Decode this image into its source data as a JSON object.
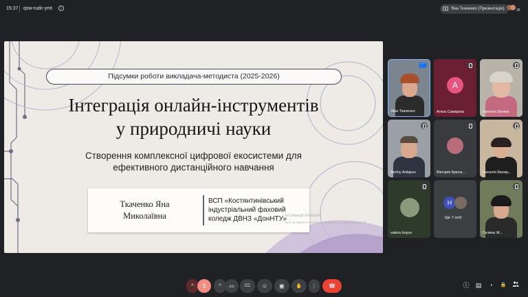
{
  "topbar": {
    "time": "15:37",
    "meeting_code": "qsw-rudc-ymt",
    "presenting_label": "Яна Ткаченко (Презентація)",
    "participants_count": "16"
  },
  "slide": {
    "banner": "Підсумки роботи викладача-методиста (2025-2026)",
    "title_line1": "Інтеграція онлайн-інструментів",
    "title_line2": "у природничі науки",
    "subtitle_line1": "Створення комплексної цифрової екосистеми для",
    "subtitle_line2": "ефективного дистанційного навчання",
    "author_line1": "Ткаченко Яна",
    "author_line2": "Миколаївна",
    "org_line1": "ВСП «Костянтинівський",
    "org_line2": "індустріальний фаховий",
    "org_line3": "коледж ДВНЗ «ДонНТУ»",
    "watermark_line1": "Активація Windows",
    "watermark_line2": "Щоб активувати Windows, перейдіть у розділ Параметри."
  },
  "participants": [
    {
      "name": "Яна Ткаченко",
      "state": "more"
    },
    {
      "name": "Аліна Самаріна",
      "avatar_letter": "A",
      "state": "muted"
    },
    {
      "name": "Наталія Зеніна",
      "state": "muted"
    },
    {
      "name": "Serhiy Artiapov",
      "state": "muted"
    },
    {
      "name": "Вікторія Крючк...",
      "state": "muted"
    },
    {
      "name": "Наталія Бікову...",
      "state": "muted"
    },
    {
      "name": "valera boyus",
      "state": "muted"
    },
    {
      "name": "Ще 7 осіб",
      "avatar_letter": "H",
      "state": "group"
    },
    {
      "name": "Галина Ж...",
      "state": "muted"
    }
  ],
  "controls": {
    "raise_chevron": "^",
    "mic": "🎙",
    "cam_chevron": "^",
    "cam": "▭",
    "captions": "CC",
    "emoji": "☺",
    "present": "▣",
    "hand": "✋",
    "more": "⋮",
    "leave": "☎",
    "info": "ⓘ",
    "chat": "▤",
    "activities": "◔",
    "lock": "🔒"
  },
  "colors": {
    "background": "#202124",
    "leave_red": "#ea4335",
    "muted_mic_red": "#5c2b29",
    "slide_bg": "#eeeae6"
  }
}
